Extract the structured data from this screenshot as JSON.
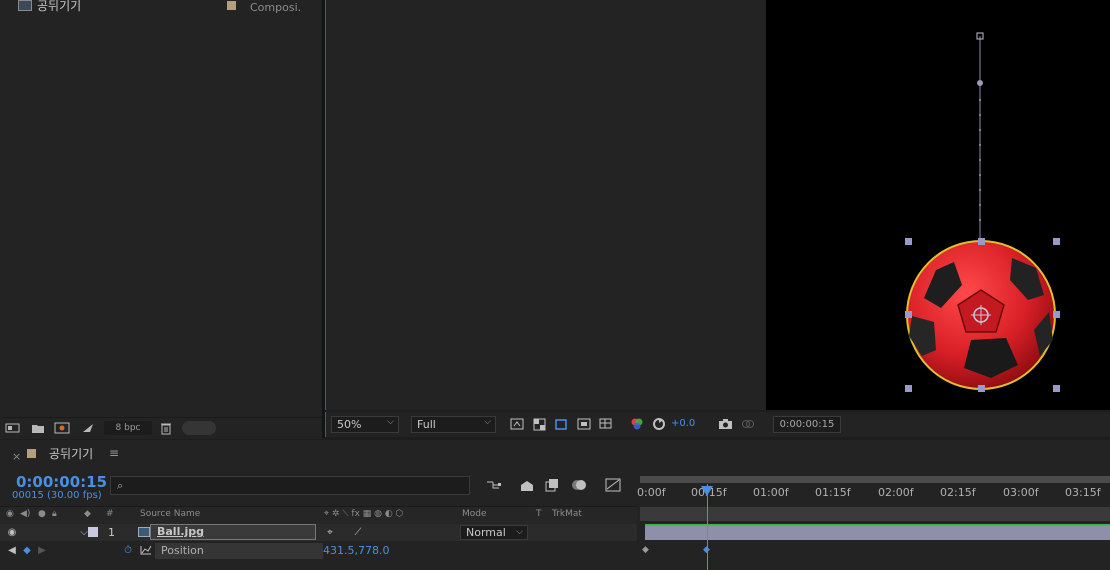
{
  "project": {
    "item_name": "공뒤기기",
    "item_type": "Composi.",
    "bpc_label": "8 bpc"
  },
  "viewer": {
    "zoom": "50%",
    "resolution": "Full",
    "exposure": "+0.0",
    "timecode": "0:00:00:15"
  },
  "timeline": {
    "tab_close": "×",
    "comp_name": "공뒤기기",
    "menu_glyph": "≡",
    "current_time": "0:00:00:15",
    "current_frames": "00015 (30.00 fps)",
    "search_icon": "⌕",
    "headers": {
      "number": "#",
      "source_name": "Source Name",
      "mode": "Mode",
      "t": "T",
      "trkmat": "TrkMat"
    },
    "layer": {
      "index": "1",
      "name": "Ball.jpg",
      "mode": "Normal"
    },
    "property": {
      "name": "Position",
      "value": "431.5,778.0"
    },
    "ruler_labels": [
      "0:00f",
      "00:15f",
      "01:00f",
      "01:15f",
      "02:00f",
      "02:15f",
      "03:00f",
      "03:15f"
    ]
  },
  "colors": {
    "accent": "#4a90e2",
    "comp_swatch": "#b5a07a",
    "layer_bar": "#8d90a8",
    "ball_red": "#d81f26"
  }
}
